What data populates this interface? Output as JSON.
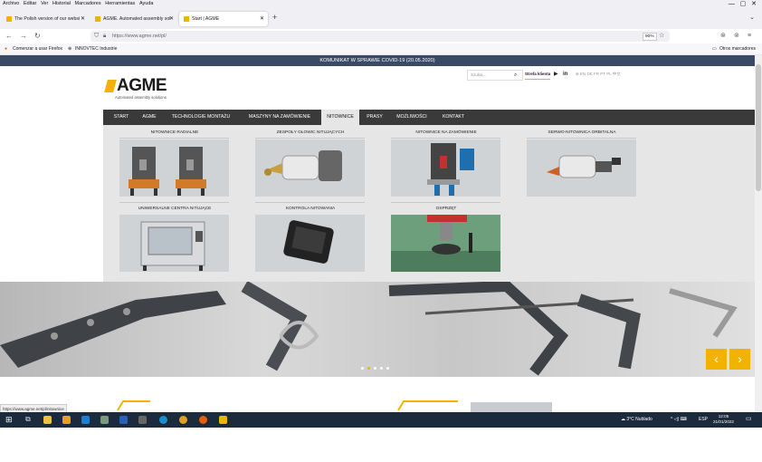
{
  "menubar": [
    "Archivo",
    "Editar",
    "Ver",
    "Historial",
    "Marcadores",
    "Herramientas",
    "Ayuda"
  ],
  "tabs": [
    {
      "title": "The Polish version of our websi"
    },
    {
      "title": "AGME. Automated assembly sol"
    },
    {
      "title": "Start | AGME"
    }
  ],
  "url": "https://www.agme.net/pl/",
  "zoom": "90%",
  "bookmarks": {
    "items": [
      "Comenzar a usar Firefox",
      "INNOVTEC Industrie"
    ],
    "other": "Otros marcadores"
  },
  "page": {
    "covid_banner": "KOMUNIKAT W SPRAWIE COVID-19 (20.05.2020)",
    "logo": {
      "text": "AGME",
      "subtitle": "Automated assembly solutions"
    },
    "search_placeholder": "Szukaj...",
    "client_zone": "Strefa klienta",
    "languages": "EN  DE  FR  PT  PL  中文",
    "nav": [
      "START",
      "AGME",
      "TECHNOLOGIE MONTAŻU",
      "MASZYNY NA ZAMÓWIENIE",
      "NITOWNICE",
      "PRASY",
      "MOŻLIWOŚCI",
      "KONTAKT"
    ],
    "nav_selected": "NITOWNICE",
    "mega_menu": [
      "NITOWNICE RADIALNE",
      "ZESPOŁY GŁOWIC NITUJĄCYCH",
      "NITOWNICE NA ZAMÓWIENIE",
      "SERWO-NITOWNICA ORBITALNA",
      "UNIWERSALNE CENTRA NITUJĄCE",
      "KONTROLA NITOWANIA",
      "OSPRZĘT"
    ],
    "carousel_dots": 5,
    "carousel_active": 1
  },
  "status_url": "https://www.agme.net/pl/nitownice",
  "taskbar": {
    "weather": "3°C  Nublado",
    "lang": "ESP",
    "time": "12:05",
    "date": "21/01/2022"
  },
  "colors": {
    "accent": "#f2b300",
    "nav_bg": "#3a3a3a",
    "banner_bg": "#3a4a66",
    "taskbar_bg": "#1c2a3d"
  }
}
